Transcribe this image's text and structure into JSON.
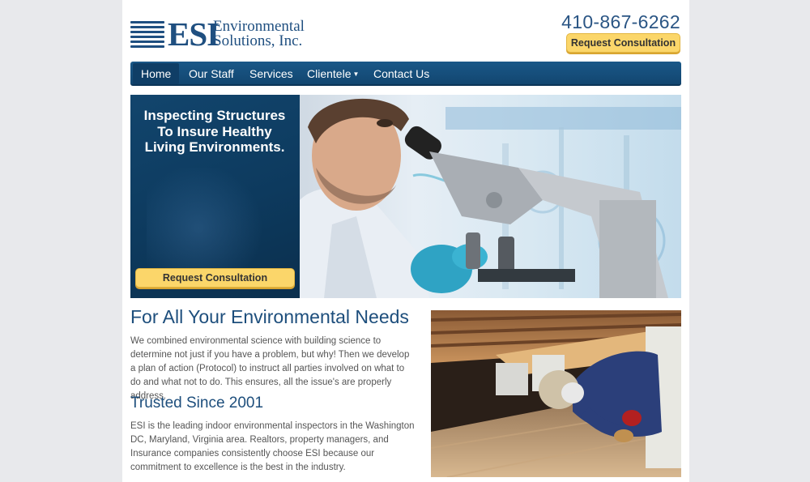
{
  "header": {
    "logo_mark": "ESI",
    "logo_line1": "Environmental",
    "logo_line2": "Solutions, Inc.",
    "phone": "410-867-6262",
    "cta_label": "Request Consultation"
  },
  "nav": {
    "items": [
      {
        "label": "Home",
        "active": true
      },
      {
        "label": "Our Staff"
      },
      {
        "label": "Services"
      },
      {
        "label": "Clientele",
        "dropdown": true
      },
      {
        "label": "Contact Us"
      }
    ]
  },
  "hero": {
    "headline_line1": "Inspecting Structures",
    "headline_line2": "To Insure Healthy",
    "headline_line3": "Living Environments.",
    "cta_label": "Request Consultation"
  },
  "content": {
    "heading1": "For All Your Environmental Needs",
    "paragraph1": "We combined environmental science with building science to determine not just if you have a problem, but why!  Then we develop a plan of action (Protocol) to instruct all parties involved on what to do and what not to do.  This ensures, all the issue's are properly address.",
    "heading2": "Trusted Since 2001",
    "paragraph2": "ESI is the leading indoor environmental inspectors in the Washington DC, Maryland, Virginia area.  Realtors, property managers, and Insurance companies consistently choose ESI because our commitment to excellence is the best in the industry."
  },
  "colors": {
    "brand_blue": "#1f4f80",
    "nav_blue": "#124670",
    "cta_yellow": "#fbd66a",
    "page_bg": "#e8e9ec"
  }
}
